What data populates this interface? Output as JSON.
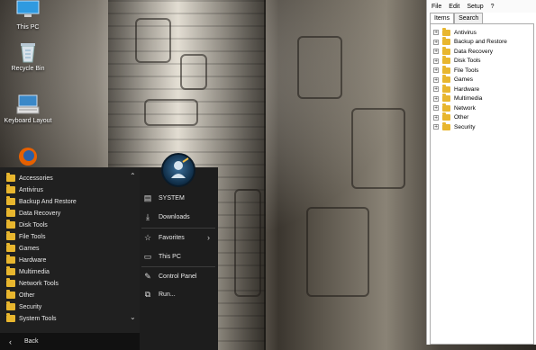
{
  "desktop": {
    "icons": [
      {
        "label": "This PC",
        "icon": "this-pc-icon"
      },
      {
        "label": "Recycle Bin",
        "icon": "recycle-bin-icon"
      },
      {
        "label": "Keyboard Layout",
        "icon": "keyboard-icon"
      }
    ]
  },
  "start_menu": {
    "folders": [
      "Accessories",
      "Antivirus",
      "Backup And Restore",
      "Data Recovery",
      "Disk Tools",
      "File Tools",
      "Games",
      "Hardware",
      "Multimedia",
      "Network Tools",
      "Other",
      "Security",
      "System Tools"
    ],
    "back_label": "Back",
    "right_items": [
      {
        "label": "SYSTEM",
        "icon": "user-icon"
      },
      {
        "label": "Downloads",
        "icon": "download-icon"
      },
      {
        "label": "Favorites",
        "icon": "star-icon"
      },
      {
        "label": "This PC",
        "icon": "computer-icon"
      },
      {
        "label": "Control Panel",
        "icon": "wrench-icon"
      },
      {
        "label": "Run...",
        "icon": "run-icon"
      }
    ]
  },
  "explorer": {
    "menu": [
      "File",
      "Edit",
      "Setup",
      "?"
    ],
    "tabs": [
      "Items",
      "Search"
    ],
    "tree": [
      "Antivirus",
      "Backup and Restore",
      "Data Recovery",
      "Disk Tools",
      "File Tools",
      "Games",
      "Hardware",
      "Multimedia",
      "Network",
      "Other",
      "Security"
    ]
  },
  "colors": {
    "folder": "#e8b62e",
    "menu_bg": "#1d1d1d"
  }
}
